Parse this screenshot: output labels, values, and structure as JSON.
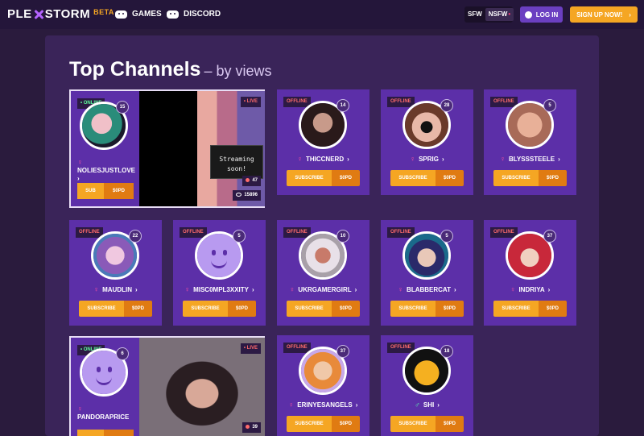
{
  "nav": {
    "logo_left": "PLE",
    "logo_right": "STORM",
    "beta": "BETA",
    "games": "GAMES",
    "discord": "DISCORD",
    "sfw": "SFW",
    "nsfw": "NSFW",
    "login": "LOG IN",
    "signup": "SIGN UP NOW!",
    "signup_arrow": "›"
  },
  "page": {
    "title": "Top Channels",
    "subtitle": "– by views"
  },
  "featured": [
    {
      "status": "• ONLINE",
      "count": "15",
      "name": "NOLIESJUSTLOVE",
      "chev": "›",
      "sub": "SUB",
      "price": "$0PD",
      "live": "• LIVE",
      "soon_line1": "Streaming",
      "soon_line2": "soon!",
      "stat_top": "47",
      "stat_bottom": "15896"
    },
    {
      "status": "• ONLINE",
      "count": "6",
      "name": "PANDORAPRICE",
      "chev": "",
      "sub": "",
      "price": "",
      "live": "• LIVE",
      "stat_bottom": "39"
    }
  ],
  "channels": [
    {
      "status": "OFFLINE",
      "count": "14",
      "name": "THICCNERD",
      "gender": "♀",
      "sub": "SUBSCRIBE",
      "price": "$0PD"
    },
    {
      "status": "OFFLINE",
      "count": "28",
      "name": "SPRIG",
      "gender": "♀",
      "sub": "SUBSCRIBE",
      "price": "$0PD"
    },
    {
      "status": "OFFLINE",
      "count": "5",
      "name": "BLYSSSTEELE",
      "gender": "♀",
      "sub": "SUBSCRIBE",
      "price": "$0PD"
    },
    {
      "status": "OFFLINE",
      "count": "22",
      "name": "MAUDLIN",
      "gender": "♀",
      "sub": "SUBSCRIBE",
      "price": "$0PD"
    },
    {
      "status": "OFFLINE",
      "count": "5",
      "name": "MISC0MPL3XXITY",
      "gender": "♀",
      "sub": "SUBSCRIBE",
      "price": "$0PD"
    },
    {
      "status": "OFFLINE",
      "count": "10",
      "name": "UKRGAMERGIRL",
      "gender": "♀",
      "sub": "SUBSCRIBE",
      "price": "$0PD"
    },
    {
      "status": "OFFLINE",
      "count": "5",
      "name": "BLABBERCAT",
      "gender": "♀",
      "sub": "SUBSCRIBE",
      "price": "$0PD"
    },
    {
      "status": "OFFLINE",
      "count": "37",
      "name": "INDRIYA",
      "gender": "♀",
      "sub": "SUBSCRIBE",
      "price": "$0PD"
    },
    {
      "status": "OFFLINE",
      "count": "37",
      "name": "ERINYESANGELS",
      "gender": "♀",
      "sub": "SUBSCRIBE",
      "price": "$0PD"
    },
    {
      "status": "OFFLINE",
      "count": "18",
      "name": "SHI",
      "gender": "♂",
      "sub": "SUBSCRIBE",
      "price": "$0PD"
    }
  ],
  "chev": "›"
}
